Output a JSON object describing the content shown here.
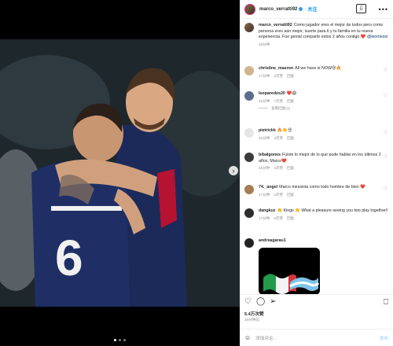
{
  "post": {
    "username": "marco_verratti92",
    "follow_label": "关注",
    "more_label": "•••",
    "download_label": "⇩"
  },
  "caption": {
    "username": "marco_verratti92",
    "text": "Como jugador eres el mejor de todos pero como persona eres aún mejor, suerte para ti y tu familia en tu nueva experiencia. Fue genial compartir estos 2 años contigo ❤️",
    "mention": "@leomessi",
    "time": "18分钟"
  },
  "comments": [
    {
      "username": "christine_masron",
      "text": "All we have is NOW😍🔥",
      "time": "17分钟",
      "likes": "2次赞",
      "reply": "回复"
    },
    {
      "username": "leoparedes20",
      "text": "❤️😱",
      "time": "15分钟",
      "likes": "7次赞",
      "reply": "回复",
      "view_replies": "查看回复(1)"
    },
    {
      "username": "pietrickk",
      "text": "🔥👏😍",
      "time": "15分钟",
      "likes": "4次赞",
      "reply": "回复"
    },
    {
      "username": "bibalgones",
      "text": "Fuiste lo mejor de lo que pude hablar en los últimos 2 años, Marco❤️",
      "time": "15分钟",
      "likes": "3次赞",
      "reply": "回复"
    },
    {
      "username": "74._angel",
      "text": "Marco messista como todo hombre de bien ❤️",
      "time": "17分钟",
      "likes": "2次赞",
      "reply": "回复"
    },
    {
      "username": "dangkuz",
      "text": "👏 Kings 👏 What a pleasure seeing you two play together!!",
      "time": "17分钟",
      "likes": "5次赞",
      "reply": "回复"
    },
    {
      "username": "andreagarau1",
      "text": "",
      "time": "",
      "likes": "",
      "reply": ""
    }
  ],
  "actions": {
    "like_icon": "heart-icon",
    "comment_icon": "comment-icon",
    "share_icon": "share-icon",
    "save_icon": "bookmark-icon",
    "likes": "5.4万次赞",
    "posted": "18分钟前"
  },
  "add_comment": {
    "placeholder": "添加评论...",
    "send_label": "发布"
  },
  "carousel": {
    "dots": 3,
    "active": 0
  },
  "colors": {
    "accent": "#0095f6",
    "verified": "#3897f0",
    "jersey": "#1c2a5a"
  }
}
